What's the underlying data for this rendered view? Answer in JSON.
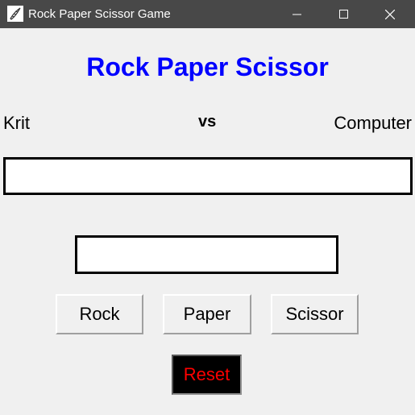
{
  "window": {
    "title": "Rock Paper Scissor Game",
    "icon": "feather-icon",
    "controls": [
      "minimize-icon",
      "maximize-icon",
      "close-icon"
    ]
  },
  "game": {
    "heading": "Rock Paper Scissor",
    "player_name": "Krit",
    "vs_label": "vs",
    "opponent_name": "Computer",
    "result_value": "",
    "choice_value": ""
  },
  "buttons": {
    "rock": "Rock",
    "paper": "Paper",
    "scissor": "Scissor",
    "reset": "Reset"
  },
  "colors": {
    "titlebar": "#484848",
    "heading": "#0000ff",
    "background": "#f0f0f0",
    "reset_background": "#000000",
    "reset_text": "#ff0000"
  }
}
